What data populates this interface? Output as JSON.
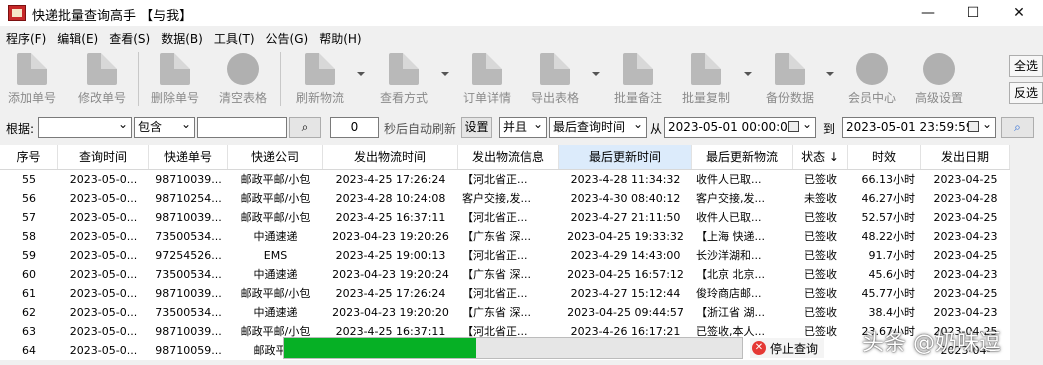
{
  "window": {
    "title": "快递批量查询高手 【与我】",
    "controls": {
      "minimize": "—",
      "maximize": "☐",
      "close": "✕"
    }
  },
  "menu": [
    "程序(F)",
    "编辑(E)",
    "查看(S)",
    "数据(B)",
    "工具(T)",
    "公告(G)",
    "帮助(H)"
  ],
  "toolbar": [
    {
      "label": "添加单号",
      "icon": "document-icon"
    },
    {
      "label": "修改单号",
      "icon": "pencil-icon"
    },
    {
      "label": "删除单号",
      "icon": "delete-document-icon"
    },
    {
      "label": "清空表格",
      "icon": "clear-circle-icon"
    },
    {
      "label": "刷新物流",
      "icon": "refresh-document-icon"
    },
    {
      "label": "查看方式",
      "icon": "view-document-icon"
    },
    {
      "label": "订单详情",
      "icon": "order-detail-icon"
    },
    {
      "label": "导出表格",
      "icon": "export-icon"
    },
    {
      "label": "批量备注",
      "icon": "note-icon"
    },
    {
      "label": "批量复制",
      "icon": "copy-icon"
    },
    {
      "label": "备份数据",
      "icon": "backup-icon"
    },
    {
      "label": "会员中心",
      "icon": "clock-icon"
    },
    {
      "label": "高级设置",
      "icon": "gear-icon"
    }
  ],
  "side_buttons": {
    "select_all": "全选",
    "invert": "反选"
  },
  "search": {
    "label": "根据:",
    "field_value": "",
    "match_mode": "包含",
    "keyword": "",
    "refresh_seconds": "0",
    "auto_refresh_label": "秒后自动刷新",
    "settings_button": "设置",
    "logic": "并且",
    "time_field": "最后查询时间",
    "from_label": "从",
    "from": "2023-05-01 00:00:00",
    "to_label": "到",
    "to": "2023-05-01 23:59:59"
  },
  "table": {
    "columns": [
      "序号",
      "查询时间",
      "快递单号",
      "快递公司",
      "发出物流时间",
      "发出物流信息",
      "最后更新时间",
      "最后更新物流",
      "状态 ↓",
      "时效",
      "发出日期"
    ],
    "rows": [
      [
        "55",
        "2023-05-0...",
        "98710039...",
        "邮政平邮/小包",
        "2023-4-25 17:26:24",
        "【河北省正...",
        "2023-4-28 11:34:32",
        "收件人已取...",
        "已签收",
        "66.13小时",
        "2023-04-25"
      ],
      [
        "56",
        "2023-05-0...",
        "98710254...",
        "邮政平邮/小包",
        "2023-4-28 10:24:08",
        "客户交接,发...",
        "2023-4-30 08:40:12",
        "客户交接,发...",
        "未签收",
        "46.27小时",
        "2023-04-28"
      ],
      [
        "57",
        "2023-05-0...",
        "98710039...",
        "邮政平邮/小包",
        "2023-4-25 16:37:11",
        "【河北省正...",
        "2023-4-27 21:11:50",
        "收件人已取...",
        "已签收",
        "52.57小时",
        "2023-04-25"
      ],
      [
        "58",
        "2023-05-0...",
        "73500534...",
        "中通速递",
        "2023-04-23 19:20:26",
        "【广东省 深...",
        "2023-04-25 19:33:32",
        "【上海 快递...",
        "已签收",
        "48.22小时",
        "2023-04-23"
      ],
      [
        "59",
        "2023-05-0...",
        "97254526...",
        "EMS",
        "2023-4-25 19:00:13",
        "【河北省正...",
        "2023-4-29 14:43:00",
        "长沙洋湖和...",
        "已签收",
        "91.7小时",
        "2023-04-25"
      ],
      [
        "60",
        "2023-05-0...",
        "73500534...",
        "中通速递",
        "2023-04-23 19:20:24",
        "【广东省 深...",
        "2023-04-25 16:57:12",
        "【北京 北京...",
        "已签收",
        "45.6小时",
        "2023-04-23"
      ],
      [
        "61",
        "2023-05-0...",
        "98710039...",
        "邮政平邮/小包",
        "2023-4-25 17:26:24",
        "【河北省正...",
        "2023-4-27 15:12:44",
        "俊玲商店邮...",
        "已签收",
        "45.77小时",
        "2023-04-25"
      ],
      [
        "62",
        "2023-05-0...",
        "73500534...",
        "中通速递",
        "2023-04-23 19:20:20",
        "【广东省 深...",
        "2023-04-25 09:44:57",
        "【浙江省 湖...",
        "已签收",
        "38.4小时",
        "2023-04-23"
      ],
      [
        "63",
        "2023-05-0...",
        "98710039...",
        "邮政平邮/小包",
        "2023-4-25 16:37:11",
        "【河北省正...",
        "2023-4-26 16:17:21",
        "已签收,本人...",
        "已签收",
        "23.67小时",
        "2023-04-25"
      ],
      [
        "64",
        "2023-05-0...",
        "98710059...",
        "邮政平邮",
        "",
        "",
        "",
        "",
        "",
        "",
        "2023-04-"
      ]
    ]
  },
  "progress": {
    "fraction": 0.42
  },
  "stop_button": "停止查询",
  "watermark": "头条 @奶味逗"
}
